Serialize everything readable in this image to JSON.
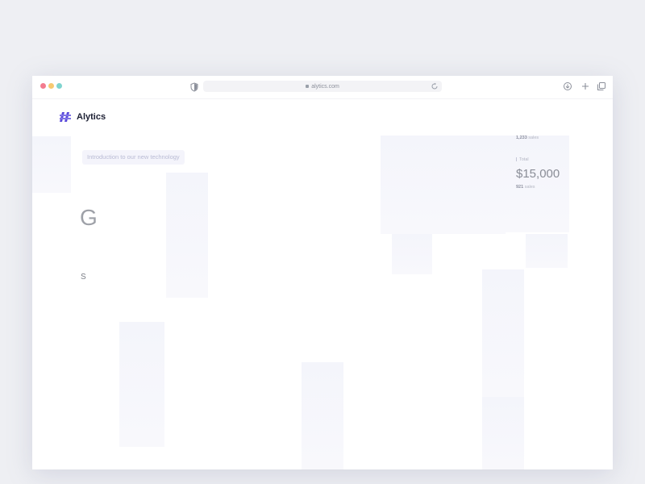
{
  "browser": {
    "url": "alytics.com"
  },
  "brand": {
    "name": "Alytics",
    "accent": "#5b4bdb"
  },
  "hero": {
    "intro_text": "Introduction to our new technology",
    "heading_letter": "G",
    "sub_letter": "S"
  },
  "stats": {
    "top_count": "1,233",
    "top_count_unit": "sales",
    "total_label": "Total",
    "total_value": "$15,000",
    "bottom_count": "921",
    "bottom_count_unit": "sales"
  }
}
